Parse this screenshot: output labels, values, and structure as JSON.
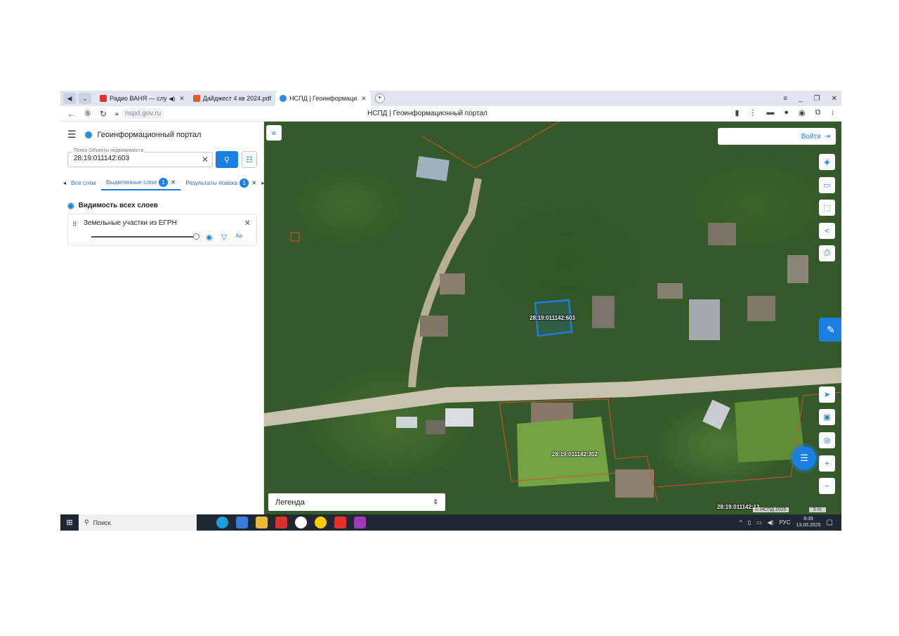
{
  "browser": {
    "tabs": [
      {
        "label": "Радио ВАНЯ — слу",
        "favicon_color": "#e03030",
        "icon": "speaker-icon",
        "active": false
      },
      {
        "label": "Дайджест 4 кв 2024.pdf",
        "favicon_color": "#e25a2b",
        "icon": "pdf-icon",
        "active": false
      },
      {
        "label": "НСПД | Геоинформаци",
        "favicon_color": "#2b8be0",
        "icon": "portal-icon",
        "active": true
      }
    ],
    "new_tab": "+",
    "url": "nspd.gov.ru",
    "page_title": "НСПД | Геоинформационный портал"
  },
  "panel": {
    "title": "Геоинформационный портал",
    "search": {
      "label": "Поиск Объекты недвижимости",
      "value": "28:19:011142:603"
    },
    "tabs": [
      {
        "label": "Все слои",
        "badge": "",
        "active": false
      },
      {
        "label": "Выделенные слои",
        "badge": "1",
        "active": true
      },
      {
        "label": "Результаты поиска",
        "badge": "1",
        "active": false
      }
    ],
    "visibility_label": "Видимость всех слоев",
    "layer_name": "Земельные участки из ЕГРН",
    "layer_opacity_pct": 100
  },
  "map": {
    "login_label": "Войти",
    "legend_label": "Легенда",
    "parcel_labels": [
      "28:19:011142:603",
      "28:19:011142:302",
      "28:19:011142:13"
    ],
    "scale_left": "© НСПД 2025",
    "scale_right": "5 m",
    "highlight_color": "#1a7fe0",
    "boundary_color": "#d2532c"
  },
  "taskbar": {
    "search_label": "Поиск",
    "lang": "РУС",
    "time": "8:39",
    "date": "13.05.2025"
  }
}
